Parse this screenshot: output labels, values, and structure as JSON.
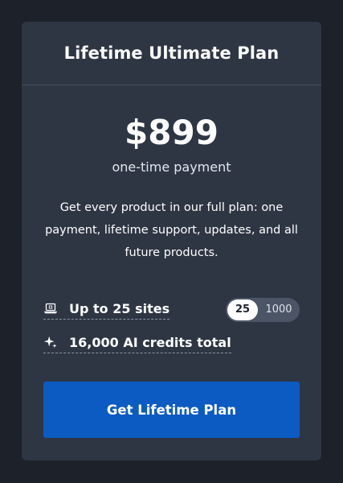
{
  "plan": {
    "title": "Lifetime Ultimate Plan",
    "price": "$899",
    "price_caption": "one-time payment",
    "description": "Get every product in our full plan: one payment, lifetime support, updates, and all future products."
  },
  "features": {
    "sites": {
      "label": "Up to 25 sites",
      "icon": "laptop-icon",
      "toggle_options": [
        "25",
        "1000"
      ],
      "selected": "25"
    },
    "credits": {
      "label": "16,000 AI credits total",
      "icon": "sparkle-icon"
    }
  },
  "cta": {
    "label": "Get Lifetime Plan"
  },
  "colors": {
    "background": "#1c212a",
    "card": "#2e3644",
    "accent": "#0b5bc2"
  }
}
